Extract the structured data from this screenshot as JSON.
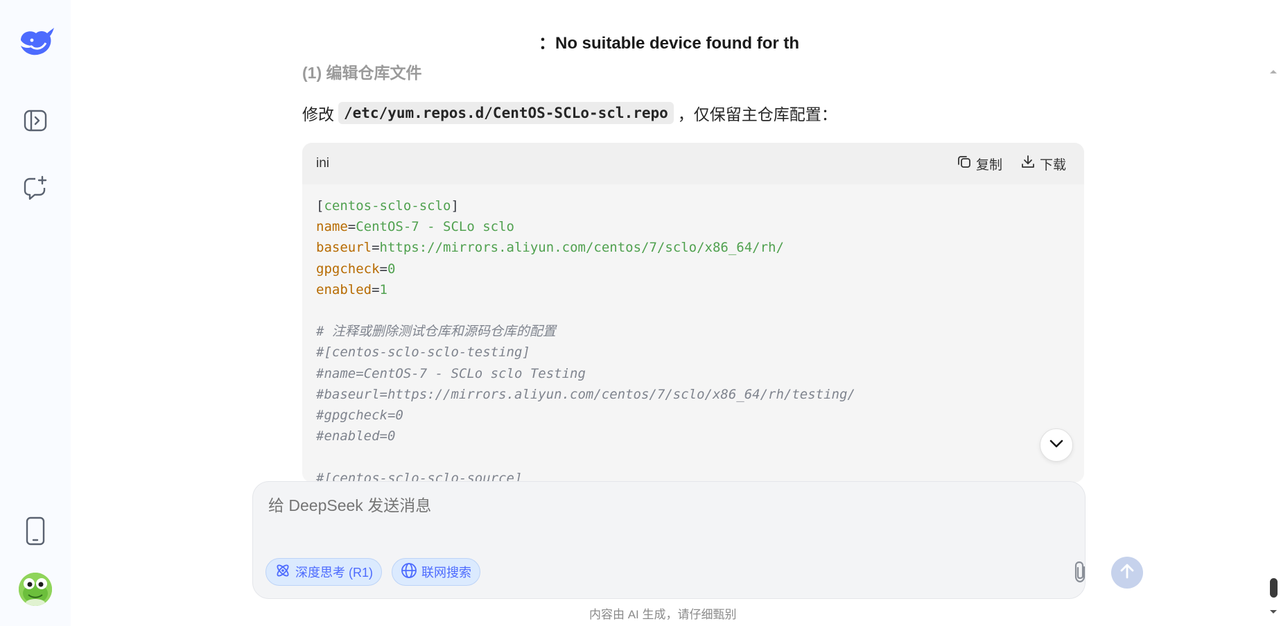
{
  "sidebar": {
    "logo_icon": "deepseek-whale-icon",
    "brand_color": "#4d6bfe",
    "items": [
      {
        "icon": "open-sidebar-icon"
      },
      {
        "icon": "new-chat-icon"
      },
      {
        "icon": "mobile-app-icon"
      }
    ],
    "avatar_icon": "frog-avatar"
  },
  "conversation": {
    "sticky_title": "：No suitable device found for th",
    "faded_heading": "(1) 编辑仓库文件",
    "paragraph": {
      "before": "修改",
      "code": "/etc/yum.repos.d/CentOS-SCLo-scl.repo",
      "after": "，仅保留主仓库配置："
    }
  },
  "code_block": {
    "language": "ini",
    "copy_label": "复制",
    "download_label": "下载",
    "lines": [
      [
        {
          "t": "plain",
          "v": "["
        },
        {
          "t": "section",
          "v": "centos-sclo-sclo"
        },
        {
          "t": "plain",
          "v": "]"
        }
      ],
      [
        {
          "t": "key",
          "v": "name"
        },
        {
          "t": "plain",
          "v": "="
        },
        {
          "t": "val",
          "v": "CentOS-7 - SCLo sclo"
        }
      ],
      [
        {
          "t": "key",
          "v": "baseurl"
        },
        {
          "t": "plain",
          "v": "="
        },
        {
          "t": "val",
          "v": "https://mirrors.aliyun.com/centos/7/sclo/x86_64/rh/"
        }
      ],
      [
        {
          "t": "key",
          "v": "gpgcheck"
        },
        {
          "t": "plain",
          "v": "="
        },
        {
          "t": "num",
          "v": "0"
        }
      ],
      [
        {
          "t": "key",
          "v": "enabled"
        },
        {
          "t": "plain",
          "v": "="
        },
        {
          "t": "num",
          "v": "1"
        }
      ],
      [
        {
          "t": "plain",
          "v": ""
        }
      ],
      [
        {
          "t": "comment",
          "v": "# 注释或删除测试仓库和源码仓库的配置"
        }
      ],
      [
        {
          "t": "comment",
          "v": "#[centos-sclo-sclo-testing]"
        }
      ],
      [
        {
          "t": "comment",
          "v": "#name=CentOS-7 - SCLo sclo Testing"
        }
      ],
      [
        {
          "t": "comment",
          "v": "#baseurl=https://mirrors.aliyun.com/centos/7/sclo/x86_64/rh/testing/"
        }
      ],
      [
        {
          "t": "comment",
          "v": "#gpgcheck=0"
        }
      ],
      [
        {
          "t": "comment",
          "v": "#enabled=0"
        }
      ],
      [
        {
          "t": "plain",
          "v": ""
        }
      ],
      [
        {
          "t": "comment",
          "v": "#[centos-sclo-sclo-source]"
        }
      ]
    ]
  },
  "composer": {
    "placeholder": "给 DeepSeek 发送消息",
    "deep_think_label": "深度思考 (R1)",
    "web_search_label": "联网搜索",
    "attach_icon": "paperclip-icon",
    "send_icon": "arrow-up-icon"
  },
  "disclaimer": "内容由 AI 生成，请仔细甄别"
}
